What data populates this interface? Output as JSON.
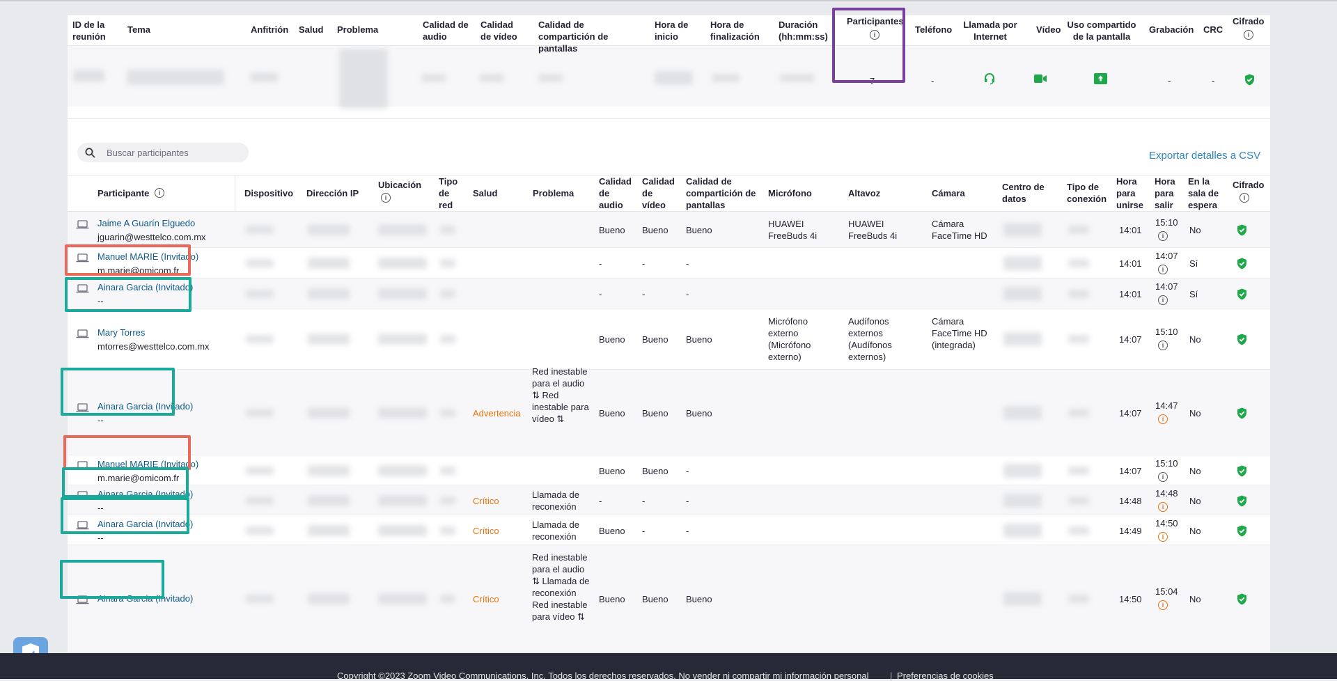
{
  "meeting_table": {
    "headers": [
      "ID de la reunión",
      "Tema",
      "Anfitrión",
      "Salud",
      "Problema",
      "Calidad de audio",
      "Calidad de vídeo",
      "Calidad de compartición de pantallas",
      "Hora de inicio",
      "Hora de finalización",
      "Duración (hh:mm:ss)",
      "Participantes",
      "Teléfono",
      "Llamada por Internet",
      "Vídeo",
      "Uso compartido de la pantalla",
      "Grabación",
      "CRC",
      "Cifrado"
    ],
    "row": {
      "participantes": "7",
      "telefono": "-",
      "grabacion": "-",
      "crc": "-"
    }
  },
  "search": {
    "placeholder": "Buscar participantes"
  },
  "export_label": "Exportar detalles a CSV",
  "participants_table": {
    "headers": [
      "Participante",
      "Dispositivo",
      "Dirección IP",
      "Ubicación",
      "Tipo de red",
      "Salud",
      "Problema",
      "Calidad de audio",
      "Calidad de vídeo",
      "Calidad de compartición de pantallas",
      "Micrófono",
      "Altavoz",
      "Cámara",
      "Centro de datos",
      "Tipo de conexión",
      "Hora para unirse",
      "Hora para salir",
      "En la sala de espera",
      "Cifrado"
    ],
    "rows": [
      {
        "name": "Jaime A Guarín Elguedo",
        "email": "jguarin@westtelco.com.mx",
        "health": "",
        "problem": "",
        "audio": "Bueno",
        "video": "Bueno",
        "share": "Bueno",
        "mic": "HUAWEI FreeBuds 4i",
        "speaker": "HUAWEI FreeBuds 4i",
        "camera": "Cámara FaceTime HD",
        "join": "14:01",
        "leave": "15:10",
        "waiting": "No"
      },
      {
        "name": "Manuel MARIE (Invitado)",
        "email": "m.marie@omicom.fr",
        "health": "",
        "problem": "",
        "audio": "-",
        "video": "-",
        "share": "-",
        "mic": "",
        "speaker": "",
        "camera": "",
        "join": "14:01",
        "leave": "14:07",
        "waiting": "Sí"
      },
      {
        "name": "Ainara Garcia (Invitado)",
        "email": "--",
        "health": "",
        "problem": "",
        "audio": "-",
        "video": "-",
        "share": "-",
        "mic": "",
        "speaker": "",
        "camera": "",
        "join": "14:01",
        "leave": "14:07",
        "waiting": "Sí"
      },
      {
        "name": "Mary Torres",
        "email": "mtorres@westtelco.com.mx",
        "health": "",
        "problem": "",
        "audio": "Bueno",
        "video": "Bueno",
        "share": "Bueno",
        "mic": "Micrófono externo (Micrófono externo)",
        "speaker": "Audífonos externos (Audífonos externos)",
        "camera": "Cámara FaceTime HD (integrada)",
        "join": "14:07",
        "leave": "15:10",
        "waiting": "No"
      },
      {
        "name": "Ainara Garcia (Invitado)",
        "email": "--",
        "health": "Advertencia",
        "problem": "Red inestable para el audio ⇅ Red inestable para vídeo ⇅",
        "audio": "Bueno",
        "video": "Bueno",
        "share": "Bueno",
        "mic": "",
        "speaker": "",
        "camera": "",
        "join": "14:07",
        "leave": "14:47",
        "waiting": "No"
      },
      {
        "name": "Manuel MARIE (Invitado)",
        "email": "m.marie@omicom.fr",
        "health": "",
        "problem": "",
        "audio": "Bueno",
        "video": "Bueno",
        "share": "-",
        "mic": "",
        "speaker": "",
        "camera": "",
        "join": "14:07",
        "leave": "15:10",
        "waiting": "No"
      },
      {
        "name": "Ainara Garcia (Invitado)",
        "email": "--",
        "health": "Crítico",
        "problem": "Llamada de reconexión",
        "audio": "-",
        "video": "-",
        "share": "-",
        "mic": "",
        "speaker": "",
        "camera": "",
        "join": "14:48",
        "leave": "14:48",
        "waiting": "No"
      },
      {
        "name": "Ainara Garcia (Invitado)",
        "email": "--",
        "health": "Crítico",
        "problem": "Llamada de reconexión",
        "audio": "Bueno",
        "video": "-",
        "share": "-",
        "mic": "",
        "speaker": "",
        "camera": "",
        "join": "14:49",
        "leave": "14:50",
        "waiting": "No"
      },
      {
        "name": "Ainara Garcia (Invitado)",
        "email": "",
        "health": "Crítico",
        "problem": "Red inestable para el audio ⇅ Llamada de reconexión Red inestable para vídeo ⇅",
        "audio": "Bueno",
        "video": "Bueno",
        "share": "Bueno",
        "mic": "",
        "speaker": "",
        "camera": "",
        "join": "14:50",
        "leave": "15:04",
        "waiting": "No"
      }
    ]
  },
  "footer": {
    "copyright": "Copyright ©2023 Zoom Video Communications, Inc. Todos los derechos reservados.  No vender ni compartir mi información personal",
    "cookies": "Preferencias de cookies"
  },
  "colors": {
    "link": "#0e5a8a",
    "warning": "#e8730c",
    "green": "#1ea84a",
    "purple": "#7b3fa0",
    "red": "#e86a5c",
    "teal": "#1ba99c"
  },
  "icons": [
    "search-icon",
    "info-icon",
    "laptop-icon",
    "shield-check-icon",
    "headset-icon",
    "video-icon",
    "share-screen-icon"
  ]
}
